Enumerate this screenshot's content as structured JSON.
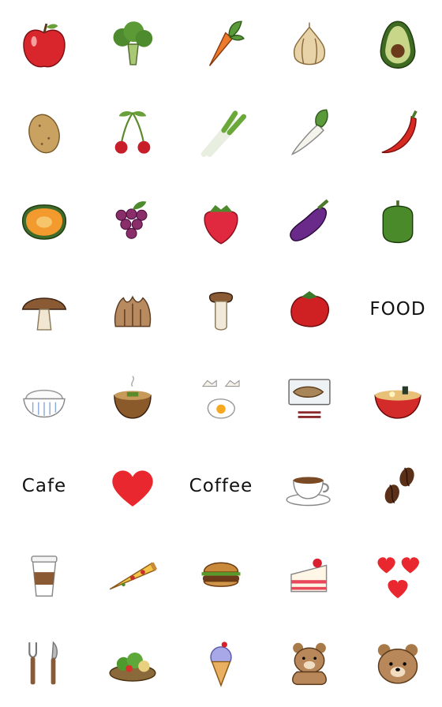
{
  "stickers": [
    {
      "kind": "apple"
    },
    {
      "kind": "broccoli"
    },
    {
      "kind": "carrot"
    },
    {
      "kind": "onion"
    },
    {
      "kind": "avocado"
    },
    {
      "kind": "potato"
    },
    {
      "kind": "cherry"
    },
    {
      "kind": "green-onion"
    },
    {
      "kind": "daikon"
    },
    {
      "kind": "chili"
    },
    {
      "kind": "pumpkin"
    },
    {
      "kind": "grapes"
    },
    {
      "kind": "strawberry"
    },
    {
      "kind": "eggplant"
    },
    {
      "kind": "bell-pepper"
    },
    {
      "kind": "shiitake"
    },
    {
      "kind": "maitake"
    },
    {
      "kind": "king-oyster"
    },
    {
      "kind": "tomato"
    },
    {
      "kind": "text",
      "text": "FOOD"
    },
    {
      "kind": "rice-bowl"
    },
    {
      "kind": "miso-soup"
    },
    {
      "kind": "egg"
    },
    {
      "kind": "fish-set"
    },
    {
      "kind": "ramen"
    },
    {
      "kind": "text",
      "text": "Cafe"
    },
    {
      "kind": "heart"
    },
    {
      "kind": "text",
      "text": "Coffee"
    },
    {
      "kind": "coffee-cup"
    },
    {
      "kind": "coffee-beans"
    },
    {
      "kind": "takeout-coffee"
    },
    {
      "kind": "pizza"
    },
    {
      "kind": "burger"
    },
    {
      "kind": "cake"
    },
    {
      "kind": "hearts"
    },
    {
      "kind": "fork-knife"
    },
    {
      "kind": "salad"
    },
    {
      "kind": "ice-cream"
    },
    {
      "kind": "bear-waving"
    },
    {
      "kind": "bear-face"
    }
  ]
}
